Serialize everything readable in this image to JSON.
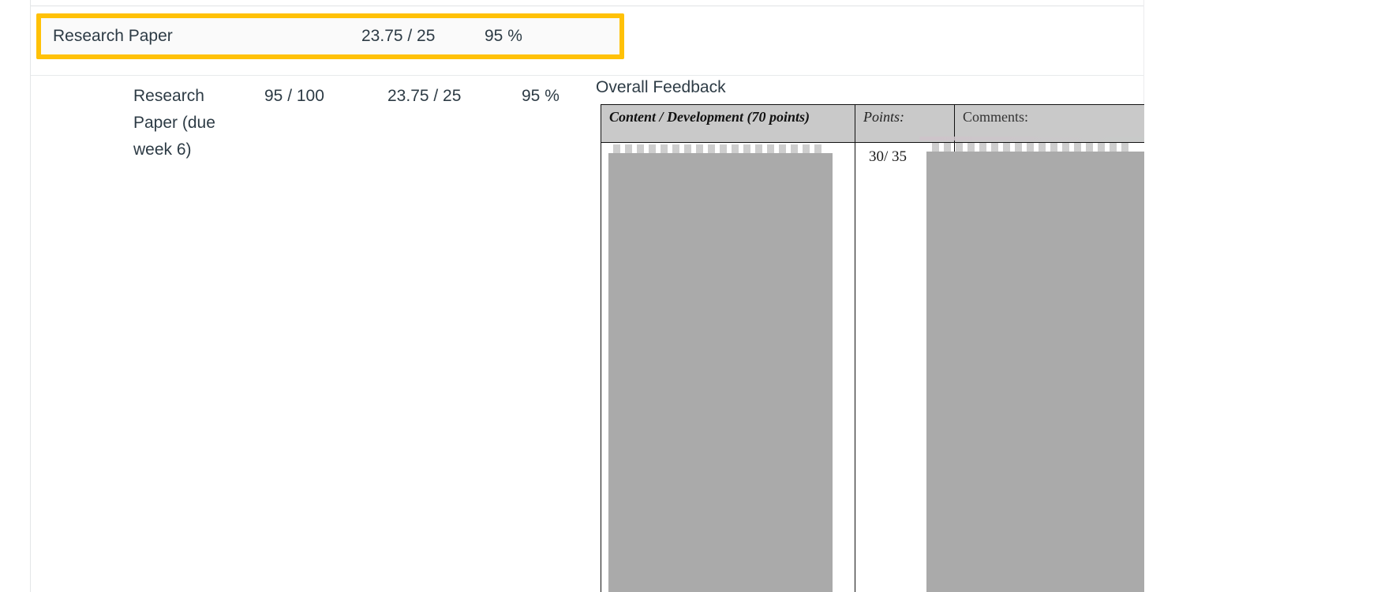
{
  "selected_row": {
    "title": "Research Paper",
    "score": "23.75 / 25",
    "percent": "95 %"
  },
  "detail_row": {
    "title": "Research Paper (due week 6)",
    "out_of": "95 / 100",
    "score": "23.75 / 25",
    "percent": "95 %"
  },
  "feedback": {
    "heading": "Overall Feedback",
    "rubric": {
      "columns": [
        "Content / Development  (70 points)",
        "Points:",
        "Comments:"
      ],
      "rows": [
        {
          "criteria": "",
          "points": "30/ 35",
          "comments": ""
        }
      ]
    }
  },
  "colors": {
    "highlight": "#ffc107",
    "rubric_header_bg": "#c9c9c9",
    "redaction": "#aaaaaa",
    "text": "#2d3b45"
  }
}
